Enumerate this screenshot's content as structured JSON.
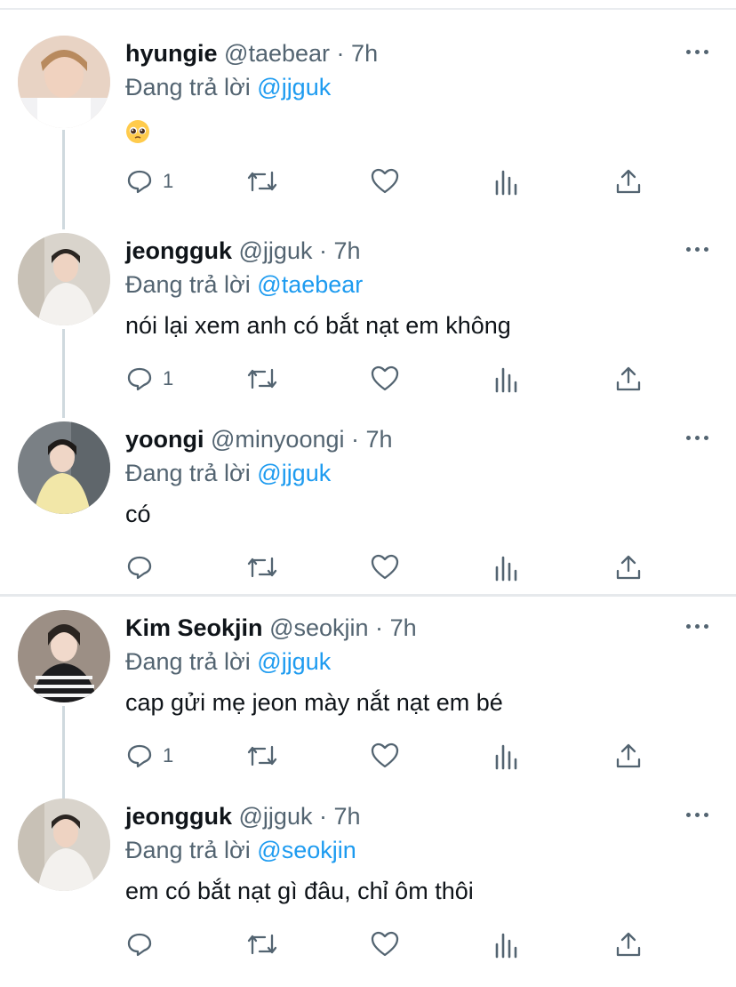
{
  "tweets": [
    {
      "name": "hyungie",
      "handle": "@taebear",
      "dot": "·",
      "time": "7h",
      "reply_prefix": "Đang trả lời",
      "reply_to": "@jjguk",
      "text": "",
      "emoji": "pleading-face",
      "reply_count": "1"
    },
    {
      "name": "jeongguk",
      "handle": "@jjguk",
      "dot": "·",
      "time": "7h",
      "reply_prefix": "Đang trả lời",
      "reply_to": "@taebear",
      "text": "nói lại xem anh có bắt nạt em không",
      "reply_count": "1"
    },
    {
      "name": "yoongi",
      "handle": "@minyoongi",
      "dot": "·",
      "time": "7h",
      "reply_prefix": "Đang trả lời",
      "reply_to": "@jjguk",
      "text": "có",
      "reply_count": ""
    },
    {
      "name": "Kim Seokjin",
      "handle": "@seokjin",
      "dot": "·",
      "time": "7h",
      "reply_prefix": "Đang trả lời",
      "reply_to": "@jjguk",
      "text": "cap gửi mẹ jeon mày nắt nạt em bé",
      "reply_count": "1"
    },
    {
      "name": "jeongguk",
      "handle": "@jjguk",
      "dot": "·",
      "time": "7h",
      "reply_prefix": "Đang trả lời",
      "reply_to": "@seokjin",
      "text": "em có bắt nạt gì đâu, chỉ ôm thôi",
      "reply_count": ""
    }
  ],
  "colors": {
    "mention": "#1d9bf0",
    "secondary_text": "#536471",
    "thread_line": "#cfd9de"
  }
}
